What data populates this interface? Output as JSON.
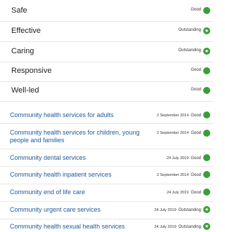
{
  "key_questions": [
    {
      "label": "Safe",
      "rating": "Good",
      "icon": "good-dot"
    },
    {
      "label": "Effective",
      "rating": "Outstanding",
      "icon": "outstanding-star"
    },
    {
      "label": "Caring",
      "rating": "Outstanding",
      "icon": "outstanding-star"
    },
    {
      "label": "Responsive",
      "rating": "Good",
      "icon": "good-dot"
    },
    {
      "label": "Well-led",
      "rating": "Good",
      "icon": "good-dot"
    }
  ],
  "services": [
    {
      "name": "Community health services for adults",
      "date": "2 September 2014",
      "rating": "Good",
      "icon": "good-dot"
    },
    {
      "name": "Community health services for children, young people and families",
      "date": "2 September 2014",
      "rating": "Good",
      "icon": "good-dot"
    },
    {
      "name": "Community dental services",
      "date": "24 July 2019",
      "rating": "Good",
      "icon": "good-dot"
    },
    {
      "name": "Community health inpatient services",
      "date": "2 September 2014",
      "rating": "Good",
      "icon": "good-dot"
    },
    {
      "name": "Community end of life care",
      "date": "24 July 2019",
      "rating": "Good",
      "icon": "good-dot"
    },
    {
      "name": "Community urgent care services",
      "date": "24 July 2019",
      "rating": "Outstanding",
      "icon": "outstanding-star"
    },
    {
      "name": "Community health sexual health services",
      "date": "24 July 2019",
      "rating": "Outstanding",
      "icon": "outstanding-star"
    }
  ],
  "colors": {
    "good": "#3a9e3a",
    "outstanding": "#3a9e3a",
    "link": "#1e5a99"
  }
}
